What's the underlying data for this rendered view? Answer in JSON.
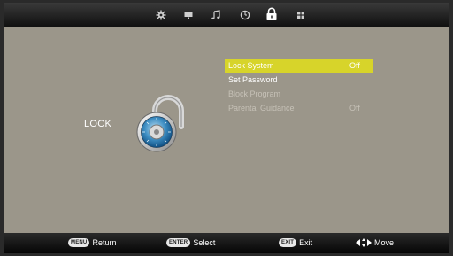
{
  "topbar": {
    "icons": [
      {
        "name": "picture-icon"
      },
      {
        "name": "screen-icon"
      },
      {
        "name": "music-note-icon"
      },
      {
        "name": "clock-icon"
      },
      {
        "name": "lock-icon",
        "active": true
      },
      {
        "name": "grid-icon"
      }
    ]
  },
  "panel": {
    "title": "LOCK",
    "menu": [
      {
        "label": "Lock  System",
        "value": "Off",
        "state": "selected"
      },
      {
        "label": "Set Password",
        "value": "",
        "state": "normal"
      },
      {
        "label": "Block Program",
        "value": "",
        "state": "disabled"
      },
      {
        "label": "Parental Guidance",
        "value": "Off",
        "state": "disabled"
      }
    ]
  },
  "bottombar": {
    "hints": [
      {
        "key": "MENU",
        "label": "Return"
      },
      {
        "key": "ENTER",
        "label": "Select"
      },
      {
        "key": "EXIT",
        "label": "Exit"
      },
      {
        "key": "",
        "label": "Move"
      }
    ]
  },
  "colors": {
    "panel_bg": "#9b968a",
    "highlight": "#d7d42a",
    "disabled_text": "#c6c1b7"
  }
}
